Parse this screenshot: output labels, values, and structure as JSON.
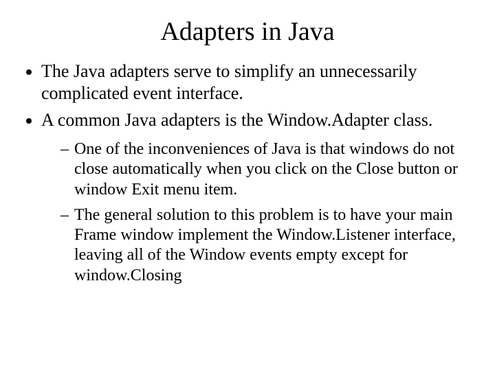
{
  "title": "Adapters in Java",
  "bullets": {
    "b1": "The Java adapters serve to simplify an unnecessarily complicated event interface.",
    "b2": "A common Java adapters is the Window.Adapter class.",
    "sub1": "One of the inconveniences of Java is that windows do not close automatically when you click on the Close button or window Exit menu item.",
    "sub2": "The general solution to this problem is to have your main Frame window implement the Window.Listener interface, leaving all of the Window events empty except for window.Closing"
  }
}
